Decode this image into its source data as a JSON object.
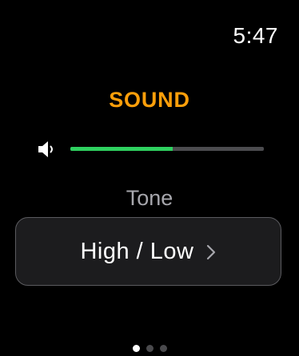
{
  "status_bar": {
    "time": "5:47"
  },
  "screen": {
    "title": "SOUND",
    "title_color": "#ff9f0a"
  },
  "volume": {
    "icon": "speaker-icon",
    "level": 0.53,
    "fill_color": "#2fd160",
    "track_color": "#4c4c4f"
  },
  "tone": {
    "label": "Tone",
    "value": "High / Low",
    "chevron_icon": "chevron-right-icon"
  },
  "pager": {
    "count": 3,
    "active_index": 0
  }
}
